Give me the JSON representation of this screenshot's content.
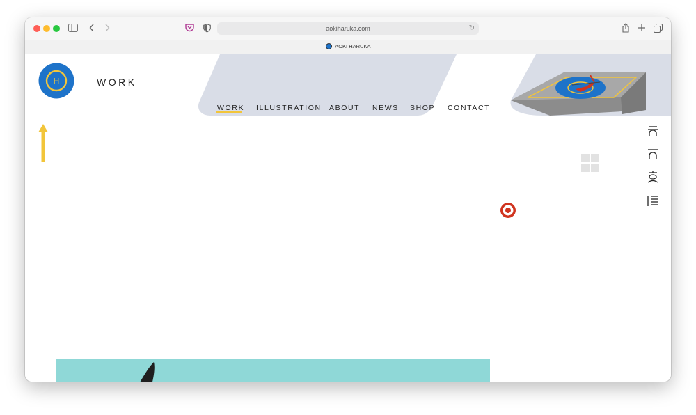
{
  "browser": {
    "url": "aokiharuka.com",
    "tab_title": "AOKI HARUKA",
    "colors": {
      "close": "#ff5f57",
      "minimize": "#febc2e",
      "maximize": "#28c840"
    },
    "icons": [
      "sidebar-icon",
      "back-icon",
      "forward-icon",
      "pocket-icon",
      "privacy-shield-icon",
      "reload-icon",
      "share-icon",
      "new-tab-icon",
      "tabs-overview-icon"
    ]
  },
  "site": {
    "logo_letter": "H",
    "page_title": "WORK",
    "nav": [
      {
        "label": "WORK",
        "active": true
      },
      {
        "label": "ILLUSTRATION",
        "active": false
      },
      {
        "label": "ABOUT",
        "active": false
      },
      {
        "label": "NEWS",
        "active": false
      },
      {
        "label": "SHOP",
        "active": false
      },
      {
        "label": "CONTACT",
        "active": false
      }
    ],
    "side_icons": [
      "side-glyph-1-icon",
      "side-glyph-2-icon",
      "side-glyph-3-icon",
      "side-glyph-4-icon"
    ],
    "colors": {
      "brand_blue": "#1e73c9",
      "accent_yellow": "#f2c53a",
      "hero_gray": "#d9dde7",
      "target_red": "#d0341f",
      "photo_teal": "#8fd8d7"
    }
  }
}
